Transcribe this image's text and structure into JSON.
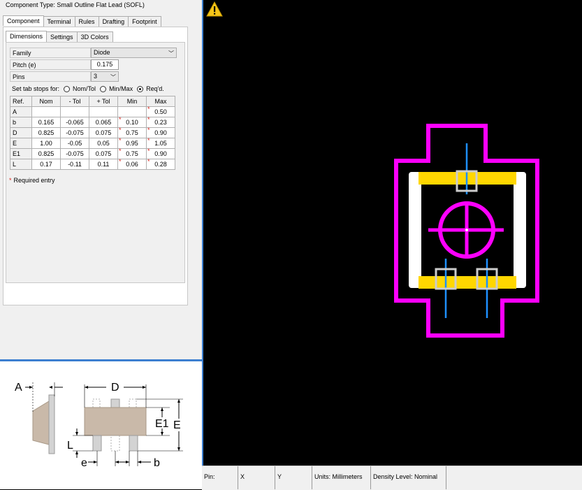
{
  "component_type": "Component Type: Small Outline Flat Lead (SOFL)",
  "tabs": [
    "Component",
    "Terminal",
    "Rules",
    "Drafting",
    "Footprint"
  ],
  "subtabs": [
    "Dimensions",
    "Settings",
    "3D Colors"
  ],
  "fields": {
    "family": {
      "label": "Family",
      "value": "Diode"
    },
    "pitch": {
      "label": "Pitch (e)",
      "value": "0.175"
    },
    "pins": {
      "label": "Pins",
      "value": "3"
    }
  },
  "tab_stops": {
    "label": "Set tab stops for:",
    "options": [
      "Nom/Tol",
      "Min/Max",
      "Req'd."
    ],
    "selected": "Req'd."
  },
  "dims_table": {
    "headers": [
      "Ref.",
      "Nom",
      "- Tol",
      "+ Tol",
      "Min",
      "Max"
    ],
    "rows": [
      {
        "ref": "A",
        "nom": "",
        "mtol": "",
        "ptol": "",
        "min": "",
        "max": "0.50",
        "min_req": false,
        "max_req": true
      },
      {
        "ref": "b",
        "nom": "0.165",
        "mtol": "-0.065",
        "ptol": "0.065",
        "min": "0.10",
        "max": "0.23",
        "min_req": true,
        "max_req": true
      },
      {
        "ref": "D",
        "nom": "0.825",
        "mtol": "-0.075",
        "ptol": "0.075",
        "min": "0.75",
        "max": "0.90",
        "min_req": true,
        "max_req": true
      },
      {
        "ref": "E",
        "nom": "1.00",
        "mtol": "-0.05",
        "ptol": "0.05",
        "min": "0.95",
        "max": "1.05",
        "min_req": true,
        "max_req": true
      },
      {
        "ref": "E1",
        "nom": "0.825",
        "mtol": "-0.075",
        "ptol": "0.075",
        "min": "0.75",
        "max": "0.90",
        "min_req": true,
        "max_req": true
      },
      {
        "ref": "L",
        "nom": "0.17",
        "mtol": "-0.11",
        "ptol": "0.11",
        "min": "0.06",
        "max": "0.28",
        "min_req": true,
        "max_req": true
      }
    ]
  },
  "required_note": "Required entry",
  "diagram_labels": {
    "A": "A",
    "D": "D",
    "E1": "E1",
    "E": "E",
    "L": "L",
    "e": "e",
    "b": "b"
  },
  "status_bar": {
    "pin": "Pin:",
    "x": "X",
    "y": "Y",
    "units": "Units: Millimeters",
    "density": "Density Level: Nominal"
  },
  "colors": {
    "silkscreen": "#ff00ff",
    "courtyard_body": "#ffffff",
    "pads": "#ffd700",
    "terminal": "#1e90ff",
    "background": "#000000",
    "warning": "#f5c518"
  }
}
